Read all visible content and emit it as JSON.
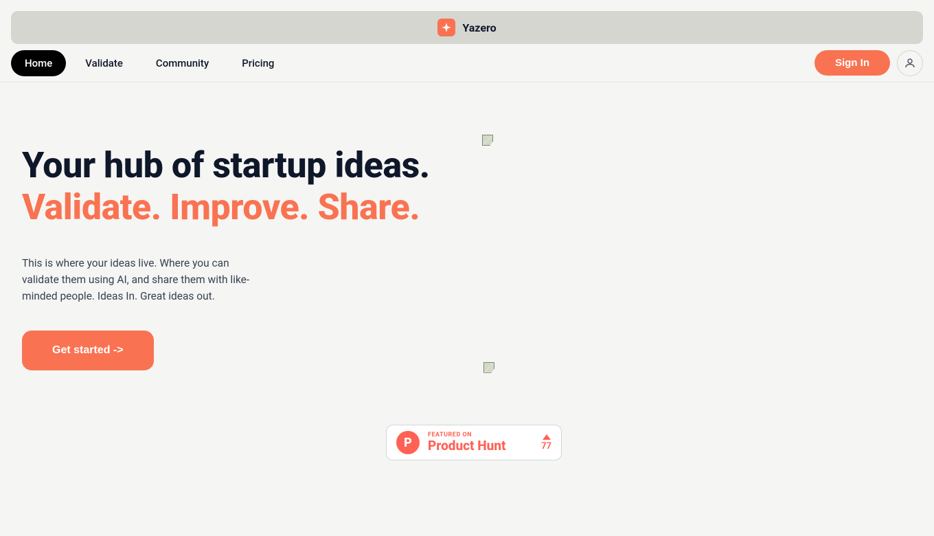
{
  "brand": {
    "name": "Yazero"
  },
  "nav": {
    "items": [
      {
        "label": "Home",
        "active": true
      },
      {
        "label": "Validate",
        "active": false
      },
      {
        "label": "Community",
        "active": false
      },
      {
        "label": "Pricing",
        "active": false
      }
    ],
    "sign_in_label": "Sign In"
  },
  "hero": {
    "title_line1": "Your hub of startup ideas.",
    "title_line2": "Validate. Improve. Share.",
    "description": "This is where your ideas live. Where you can validate them using AI, and share them with like-minded people. Ideas In. Great ideas out.",
    "cta_label": "Get started ->"
  },
  "product_hunt": {
    "featured_label": "FEATURED ON",
    "name": "Product Hunt",
    "votes": "77"
  },
  "colors": {
    "accent": "#f97352",
    "ph_accent": "#ff6154",
    "nav_active_bg": "#000000",
    "bg": "#f5f5f3",
    "brand_bar_bg": "#d6d6d1"
  }
}
